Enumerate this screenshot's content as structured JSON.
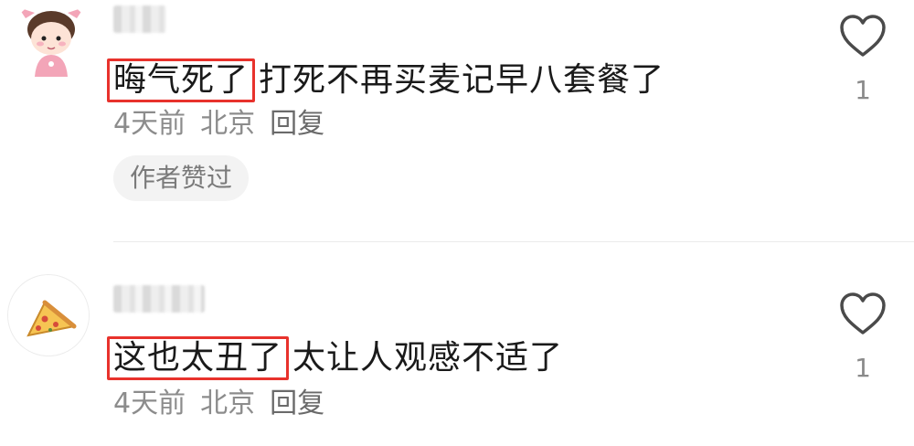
{
  "comments": [
    {
      "avatar_icon": "pig-avatar-icon",
      "highlight_text": "晦气死了",
      "text": "打死不再买麦记早八套餐了",
      "time": "4天前",
      "location": "北京",
      "reply_label": "回复",
      "badge": "作者赞过",
      "like_count": "1"
    },
    {
      "avatar_icon": "pizza-avatar-icon",
      "highlight_text": "这也太丑了",
      "text": "太让人观感不适了",
      "time": "4天前",
      "location": "北京",
      "reply_label": "回复",
      "like_count": "1"
    }
  ],
  "colors": {
    "highlight_border": "#e8322c",
    "meta_text": "#8c8c8c",
    "badge_background": "#f3f3f3"
  }
}
